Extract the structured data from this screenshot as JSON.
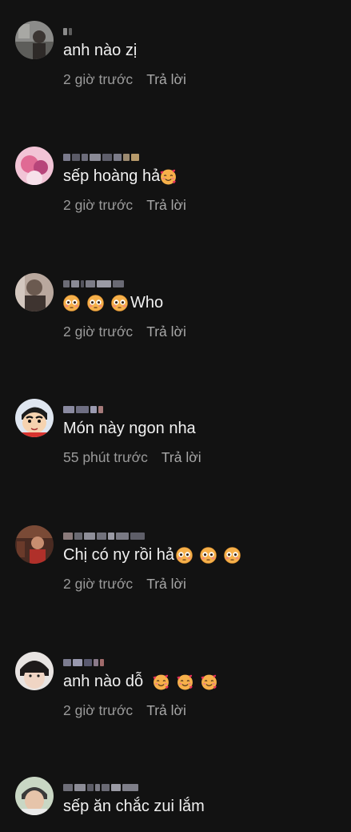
{
  "comments": [
    {
      "text": "anh nào zị",
      "time": "2 giờ trước",
      "reply": "Trả lời"
    },
    {
      "text": "sếp hoàng hả",
      "time": "2 giờ trước",
      "reply": "Trả lời",
      "emojis": [
        "smiling-hearts-emoji"
      ]
    },
    {
      "text": "Who",
      "time": "2 giờ trước",
      "reply": "Trả lời",
      "emojis": [
        "flushed-emoji",
        "flushed-emoji",
        "flushed-emoji"
      ]
    },
    {
      "text": "Món này ngon nha",
      "time": "55 phút trước",
      "reply": "Trả lời"
    },
    {
      "text": "Chị có ny rồi hả",
      "time": "2 giờ trước",
      "reply": "Trả lời",
      "emojis": [
        "flushed-emoji",
        "flushed-emoji",
        "flushed-emoji"
      ]
    },
    {
      "text": "anh nào dỗ",
      "time": "2 giờ trước",
      "reply": "Trả lời",
      "emojis": [
        "smiling-hearts-emoji",
        "smiling-hearts-emoji",
        "smiling-hearts-emoji"
      ]
    },
    {
      "text": "sếp ăn chắc zui lắm"
    }
  ],
  "colors": {
    "background": "#121212",
    "text": "#f1f1f1",
    "meta": "#9a9a9a"
  }
}
